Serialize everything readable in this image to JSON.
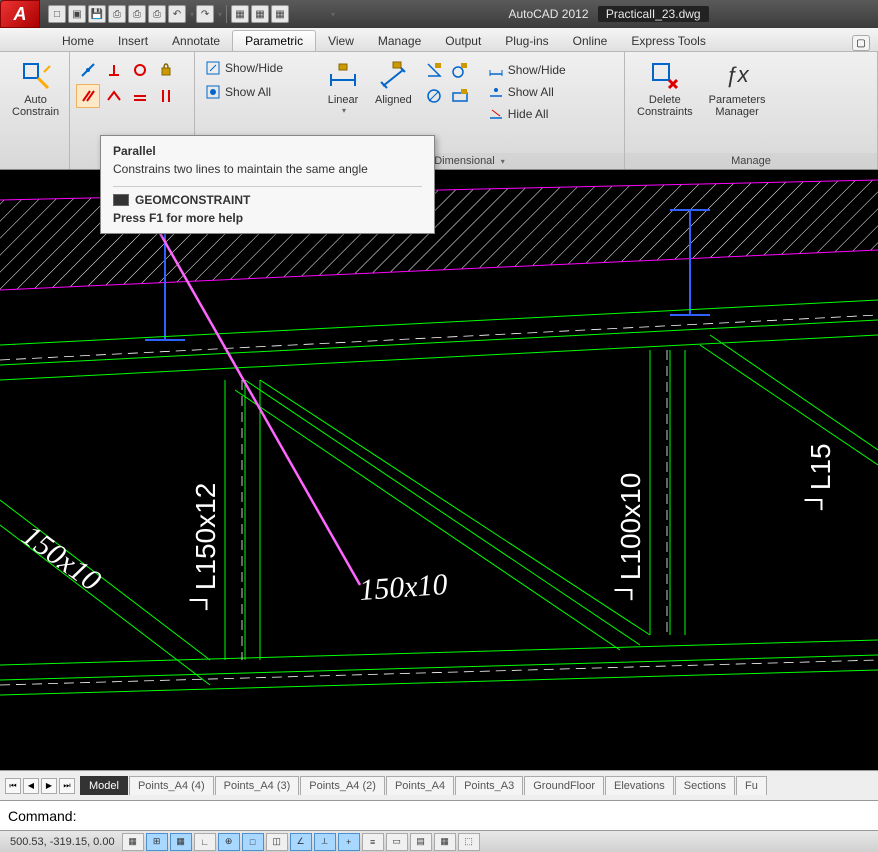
{
  "title": {
    "app": "AutoCAD 2012",
    "file": "PracticalI_23.dwg"
  },
  "qat_icons": [
    "new",
    "open",
    "save",
    "saveall",
    "print",
    "plot",
    "undo",
    "redo",
    "sep",
    "cloud",
    "ws",
    "layer"
  ],
  "tabs": [
    "Home",
    "Insert",
    "Annotate",
    "Parametric",
    "View",
    "Manage",
    "Output",
    "Plug-ins",
    "Online",
    "Express Tools"
  ],
  "active_tab": "Parametric",
  "ribbon": {
    "auto_constrain": "Auto\nConstrain",
    "geom_show_hide": "Show/Hide",
    "geom_show_all": "Show All",
    "linear": "Linear",
    "aligned": "Aligned",
    "dim_show_hide": "Show/Hide",
    "dim_show_all": "Show All",
    "dim_hide_all": "Hide All",
    "dimensional_panel": "Dimensional",
    "delete_constraints": "Delete\nConstraints",
    "parameters_manager": "Parameters\nManager",
    "manage_panel": "Manage"
  },
  "tooltip": {
    "title": "Parallel",
    "desc": "Constrains two lines to maintain the same angle",
    "cmd": "GEOMCONSTRAINT",
    "help": "Press F1 for more help"
  },
  "drawing_labels": {
    "d1": "150x10",
    "d2": "┘L150x12",
    "d3": "150x10",
    "d4": "┘L100x10",
    "d5": "┘L15"
  },
  "layout_tabs": [
    "Model",
    "Points_A4 (4)",
    "Points_A4 (3)",
    "Points_A4 (2)",
    "Points_A4",
    "Points_A3",
    "GroundFloor",
    "Elevations",
    "Sections",
    "Fu"
  ],
  "active_layout": "Model",
  "command_prompt": "Command:",
  "coords": "500.53, -319.15, 0.00",
  "status_buttons": [
    "grid",
    "snap",
    "ortho",
    "polar",
    "osnap",
    "3dosnap",
    "otrack",
    "ducs",
    "dyn",
    "lwt",
    "tpy",
    "qp",
    "sc",
    "am"
  ]
}
